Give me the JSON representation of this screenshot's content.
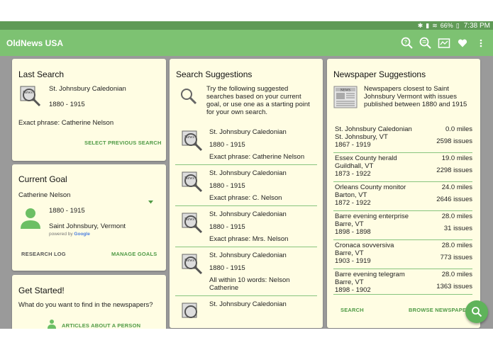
{
  "status": {
    "battery": "66%",
    "time": "7:38 PM"
  },
  "appbar": {
    "title": "OldNews USA",
    "actions": [
      "search-help-icon",
      "search-list-icon",
      "map-icon",
      "heart-icon",
      "overflow-menu-icon"
    ]
  },
  "last_search": {
    "heading": "Last Search",
    "paper": "St. Johnsbury Caledonian",
    "years": "1880 - 1915",
    "phrase": "Exact phrase:  Catherine Nelson",
    "action": "SELECT PREVIOUS SEARCH"
  },
  "current_goal": {
    "heading": "Current Goal",
    "name": "Catherine Nelson",
    "years": "1880 - 1915",
    "place": "Saint Johnsbury, Vermont",
    "powered_by": "powered by",
    "google": "Google",
    "research_log": "RESEARCH LOG",
    "manage_goals": "MANAGE GOALS"
  },
  "get_started": {
    "heading": "Get Started!",
    "question": "What do you want to find in the newspapers?",
    "option": "ARTICLES ABOUT A PERSON"
  },
  "search_suggestions": {
    "heading": "Search Suggestions",
    "intro": [
      "Try the following suggested",
      "searches based on your current",
      "goal, or use one as a starting point",
      "for your own search."
    ],
    "items": [
      {
        "paper": "St. Johnsbury Caledonian",
        "years": "1880 - 1915",
        "query": "Exact phrase:  Catherine Nelson"
      },
      {
        "paper": "St. Johnsbury Caledonian",
        "years": "1880 - 1915",
        "query": "Exact phrase:  C. Nelson"
      },
      {
        "paper": "St. Johnsbury Caledonian",
        "years": "1880 - 1915",
        "query": "Exact phrase:  Mrs. Nelson"
      },
      {
        "paper": "St. Johnsbury Caledonian",
        "years": "1880 - 1915",
        "query": "All within 10 words:  Nelson",
        "query2": "Catherine"
      },
      {
        "paper": "St. Johnsbury Caledonian"
      }
    ]
  },
  "newspaper_suggestions": {
    "heading": "Newspaper Suggestions",
    "intro": [
      "Newspapers closest to Saint",
      "Johnsbury Vermont with issues",
      "published between 1880 and 1915"
    ],
    "items": [
      {
        "name": "St. Johnsbury Caledonian",
        "place": "St. Johnsbury, VT",
        "years": "1867 - 1919",
        "distance": "0.0 miles",
        "issues": "2598 issues"
      },
      {
        "name": "Essex County herald",
        "place": "Guildhall, VT",
        "years": "1873 - 1922",
        "distance": "19.0 miles",
        "issues": "2298 issues"
      },
      {
        "name": "Orleans County monitor",
        "place": "Barton, VT",
        "years": "1872 - 1922",
        "distance": "24.0 miles",
        "issues": "2646 issues"
      },
      {
        "name": "Barre evening enterprise",
        "place": "Barre, VT",
        "years": "1898 - 1898",
        "distance": "28.0 miles",
        "issues": "31 issues"
      },
      {
        "name": "Cronaca sovversiva",
        "place": "Barre, VT",
        "years": "1903 - 1919",
        "distance": "28.0 miles",
        "issues": "773 issues"
      },
      {
        "name": "Barre evening telegram",
        "place": "Barre, VT",
        "years": "1898 - 1902",
        "distance": "28.0 miles",
        "issues": "1363 issues"
      }
    ],
    "search": "SEARCH",
    "browse": "BROWSE NEWSPAPERS"
  },
  "colors": {
    "accent": "#7dc272",
    "link": "#4f9a45",
    "card": "#fffde3",
    "background": "#9a9a9a"
  }
}
